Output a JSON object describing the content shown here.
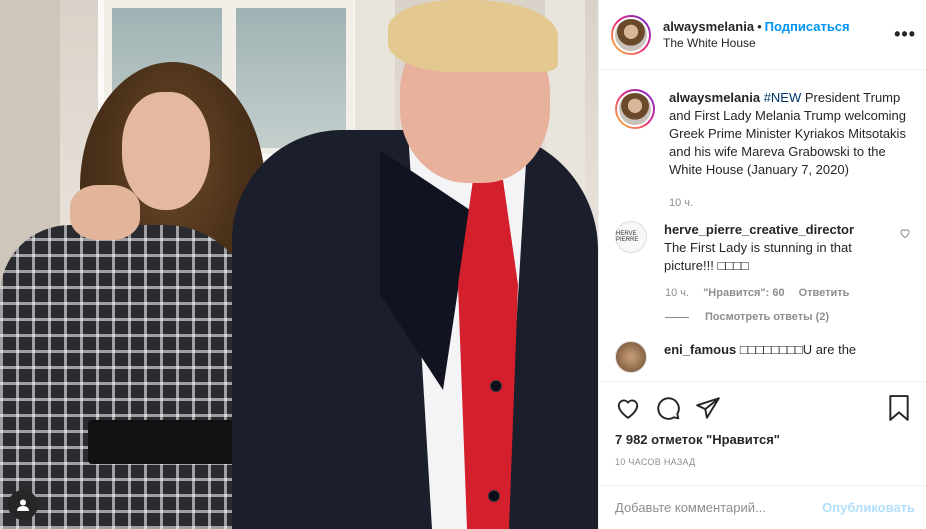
{
  "post": {
    "photo_alt": "",
    "user": "alwaysmelania",
    "dot": "•",
    "follow_label": "Подписаться",
    "location": "The White House",
    "more_label": "•••"
  },
  "caption": {
    "user": "alwaysmelania",
    "hashtag": "#NEW",
    "text": " President Trump and First Lady Melania Trump welcoming Greek Prime Minister Kyriakos Mitsotakis and his wife Mareva Grabowski to the White House (January 7, 2020)",
    "time": "10 ч."
  },
  "comments": [
    {
      "user": "herve_pierre_creative_director",
      "avatar_text": "HERVE PIERRE",
      "text": "The First Lady is stunning in that picture!!! □□□□",
      "time": "10 ч.",
      "likes": "\"Нравится\": 60",
      "reply_label": "Ответить",
      "view_replies": "Посмотреть ответы (2)"
    },
    {
      "user": "eni_famous",
      "text": "□□□□□□□□U are the"
    }
  ],
  "actions": {
    "likes": "7 982 отметок \"Нравится\"",
    "posted_ago": "10 часов назад",
    "add_comment_placeholder": "Добавьте комментарий...",
    "publish_label": "Опубликовать"
  },
  "colors": {
    "follow": "#0095f6",
    "publish_disabled": "#b2dffc",
    "hashtag": "#00376b",
    "secondary_text": "#8e8e8e"
  },
  "icons": [
    "heart-icon",
    "comment-icon",
    "share-icon",
    "bookmark-icon",
    "more-icon",
    "user-icon"
  ]
}
